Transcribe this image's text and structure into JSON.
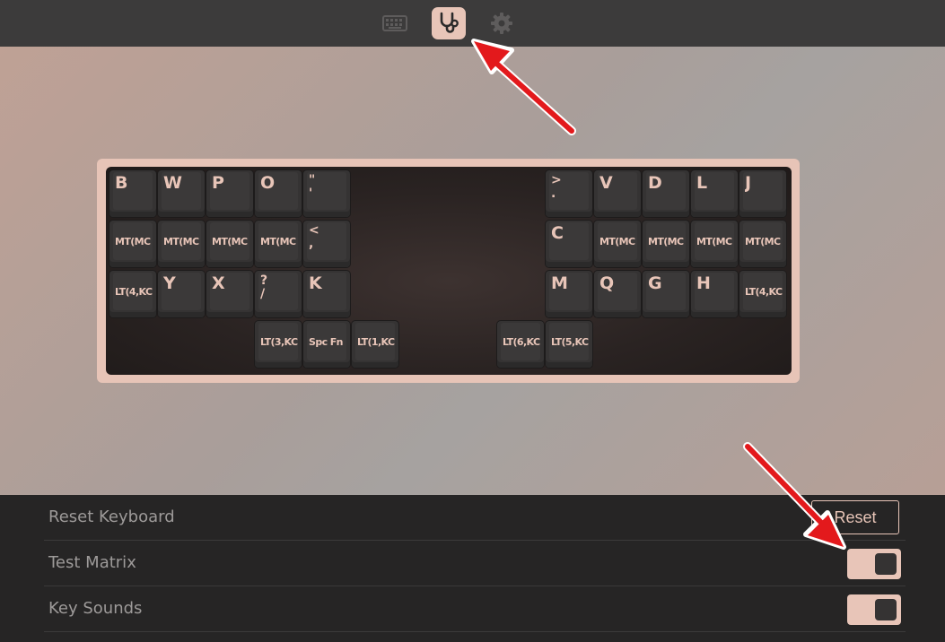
{
  "topbar": {
    "icons": [
      "keyboard-icon",
      "stethoscope-icon",
      "gear-icon"
    ],
    "active": "stethoscope-icon"
  },
  "keyboard": {
    "rows": [
      [
        "B",
        "W",
        "P",
        "O",
        "\"\n'",
        ">\n.",
        "V",
        "D",
        "L",
        "J"
      ],
      [
        "MT(MC",
        "MT(MC",
        "MT(MC",
        "MT(MC",
        "<\n,",
        "C",
        "MT(MC",
        "MT(MC",
        "MT(MC",
        "MT(MC"
      ],
      [
        "LT(4,KC",
        "Y",
        "X",
        "?\n/",
        "K",
        "M",
        "Q",
        "G",
        "H",
        "LT(4,KC"
      ],
      [
        "LT(3,KC",
        "Spc Fn",
        "LT(1,KC",
        "LT(6,KC",
        "LT(5,KC"
      ]
    ]
  },
  "settings": {
    "reset_label": "Reset Keyboard",
    "reset_button": "Reset",
    "test_matrix_label": "Test Matrix",
    "test_matrix_on": true,
    "key_sounds_label": "Key Sounds",
    "key_sounds_on": true
  },
  "colors": {
    "accent": "#e8c5b8",
    "annotation_arrow": "#e3191c"
  }
}
